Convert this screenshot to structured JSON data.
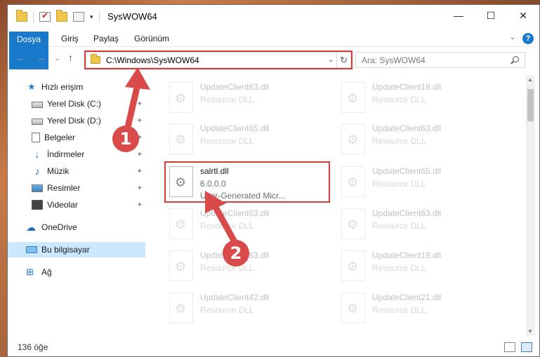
{
  "window": {
    "title": "SysWOW64",
    "controls": {
      "minimize": "—",
      "maximize": "☐",
      "close": "✕"
    }
  },
  "ribbon": {
    "tabs": [
      "Dosya",
      "Giriş",
      "Paylaş",
      "Görünüm"
    ],
    "help": "?"
  },
  "nav": {
    "back": "←",
    "forward": "→",
    "recent": "⌄",
    "up": "↑",
    "address": "C:\\Windows\\SysWOW64",
    "refresh": "↻",
    "search_placeholder": "Ara: SysWOW64"
  },
  "sidebar": {
    "items": [
      {
        "label": "Hızlı erişim",
        "icon": "star-icon",
        "pinned": false
      },
      {
        "label": "Yerel Disk (C:)",
        "icon": "drive-icon",
        "pinned": true
      },
      {
        "label": "Yerel Disk (D:)",
        "icon": "drive-icon",
        "pinned": true
      },
      {
        "label": "Belgeler",
        "icon": "documents-icon",
        "pinned": true
      },
      {
        "label": "İndirmeler",
        "icon": "downloads-icon",
        "pinned": true
      },
      {
        "label": "Müzik",
        "icon": "music-icon",
        "pinned": true
      },
      {
        "label": "Resimler",
        "icon": "pictures-icon",
        "pinned": true
      },
      {
        "label": "Videolar",
        "icon": "videos-icon",
        "pinned": true
      },
      {
        "label": "OneDrive",
        "icon": "cloud-icon",
        "pinned": false
      },
      {
        "label": "Bu bilgisayar",
        "icon": "computer-icon",
        "pinned": false,
        "selected": true
      },
      {
        "label": "Ağ",
        "icon": "network-icon",
        "pinned": false
      }
    ],
    "pin_glyph": "📌"
  },
  "files": [
    {
      "name": "UpdateClient63.dll",
      "sub": "Resource DLL"
    },
    {
      "name": "UpdateClient19.dll",
      "sub": "Resource DLL"
    },
    {
      "name": "UpdateClient65.dll",
      "sub": "Resource DLL"
    },
    {
      "name": "UpdateClient63.dll",
      "sub": "Resource DLL"
    },
    {
      "name": "salrtl.dll",
      "version": "6.0.0.0",
      "company": "User-Generated Micr...",
      "focused": true
    },
    {
      "name": "UpdateClient65.dll",
      "sub": "Resource DLL"
    },
    {
      "name": "UpdateClient63.dll",
      "sub": "Resource DLL"
    },
    {
      "name": "UpdateClient63.dll",
      "sub": "Resource DLL"
    },
    {
      "name": "UpdateClient63.dll",
      "sub": "Resource DLL"
    },
    {
      "name": "UpdateClient19.dll",
      "sub": "Resource DLL"
    },
    {
      "name": "UpdateClient42.dll",
      "sub": "Resource DLL"
    },
    {
      "name": "UpdateClient21.dll",
      "sub": "Resource DLL"
    }
  ],
  "status": {
    "count": "136 öğe"
  },
  "annotations": [
    {
      "label": "1",
      "color": "#d94a4a"
    },
    {
      "label": "2",
      "color": "#d94a4a"
    }
  ]
}
